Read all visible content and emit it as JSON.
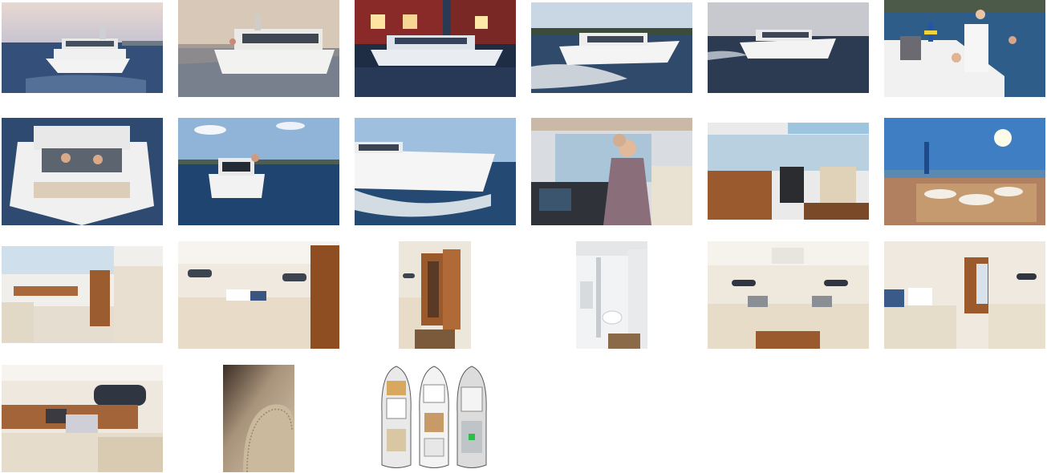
{
  "gallery": {
    "thumbnails": [
      {
        "name": "boat-front-calm-sea"
      },
      {
        "name": "boat-side-sunset"
      },
      {
        "name": "boat-at-dock-evening"
      },
      {
        "name": "boat-planing-spray"
      },
      {
        "name": "boat-side-running"
      },
      {
        "name": "family-swim-platform"
      },
      {
        "name": "boat-bow-view"
      },
      {
        "name": "boat-stern-view"
      },
      {
        "name": "boat-bow-wave"
      },
      {
        "name": "helm-navigation"
      },
      {
        "name": "salon-helm-station"
      },
      {
        "name": "cockpit-dining-table"
      },
      {
        "name": "salon-dinette"
      },
      {
        "name": "cabin-double-berth"
      },
      {
        "name": "cabin-corridor"
      },
      {
        "name": "bathroom-toilet"
      },
      {
        "name": "forward-cabin-vberth"
      },
      {
        "name": "guest-cabin-twin"
      },
      {
        "name": "aft-cabin-berth"
      },
      {
        "name": "upholstery-detail"
      },
      {
        "name": "deck-plan-layout"
      }
    ]
  },
  "colors": {
    "sea": "#3c5a80",
    "sky": "#d9c9c0",
    "hull": "#f4f4f2",
    "teak": "#a0622e",
    "upholstery": "#e8dcc8"
  }
}
